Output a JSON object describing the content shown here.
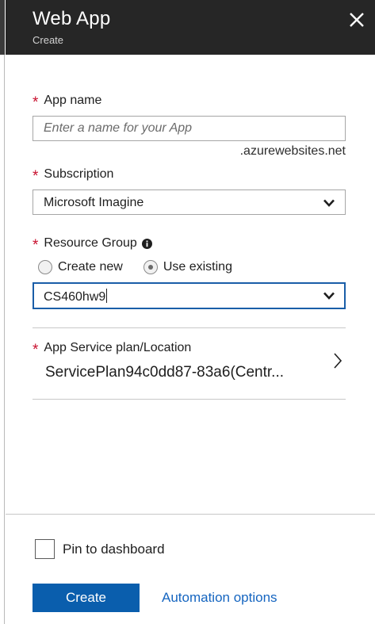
{
  "blade": {
    "title": "Web App",
    "subtitle": "Create"
  },
  "app_name": {
    "label": "App name",
    "placeholder": "Enter a name for your App",
    "value": "",
    "suffix": ".azurewebsites.net"
  },
  "subscription": {
    "label": "Subscription",
    "selected": "Microsoft Imagine"
  },
  "resource_group": {
    "label": "Resource Group",
    "options": [
      {
        "label": "Create new",
        "checked": false
      },
      {
        "label": "Use existing",
        "checked": true
      }
    ],
    "selected": "CS460hw9"
  },
  "app_service_plan": {
    "label": "App Service plan/Location",
    "value": "ServicePlan94c0dd87-83a6(Centr..."
  },
  "footer": {
    "pin_label": "Pin to dashboard",
    "pin_checked": false,
    "create_label": "Create",
    "automation_label": "Automation options"
  },
  "colors": {
    "header_bg": "#262626",
    "required": "#c8102e",
    "accent": "#0a5ead",
    "link": "#1565c0",
    "focus_border": "#1a5ea8"
  },
  "icons": {
    "close": "close-icon",
    "info": "info-icon",
    "dropdown": "chevron-down-icon",
    "navigate": "chevron-right-icon"
  }
}
